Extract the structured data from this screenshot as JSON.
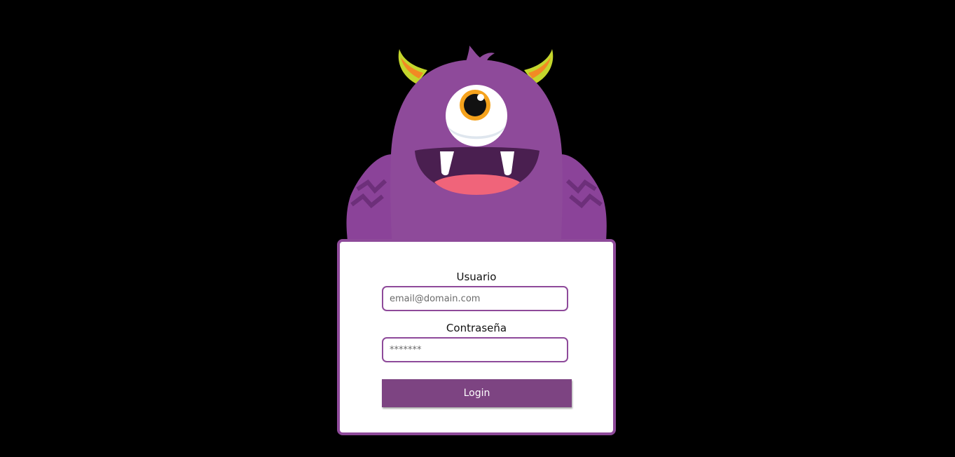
{
  "login_form": {
    "username_label": "Usuario",
    "username_placeholder": "email@domain.com",
    "password_label": "Contraseña",
    "password_placeholder": "*******",
    "login_button_label": "Login"
  },
  "mascot": {
    "icon": "purple-one-eyed-monster-illustration"
  },
  "colors": {
    "background": "#000000",
    "accent_purple": "#8e4a9a",
    "button_purple": "#7d4482",
    "card_background": "#ffffff"
  }
}
